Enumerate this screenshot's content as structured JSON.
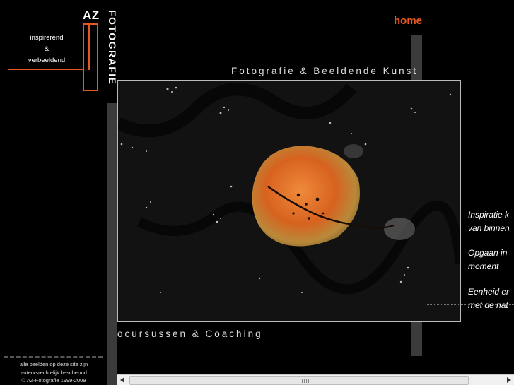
{
  "logo": {
    "az": "AZ",
    "fotografie": "FOTOGRAFIE"
  },
  "slogan": [
    "inspirerend",
    "&",
    "verbeeldend"
  ],
  "nav": {
    "home": "home"
  },
  "header_title": "Fotografie & Beeldende Kunst",
  "footer_title": "ocursussen & Coaching",
  "side_texts": [
    [
      "Inspiratie k",
      "van binnen"
    ],
    [
      "Opgaan in",
      "moment"
    ],
    [
      "Eenheid er",
      "met de nat"
    ]
  ],
  "copyright": [
    "alle beelden op deze site zijn",
    "auteursrechtelijk beschermd",
    "© AZ-Fotografie 1999-2009"
  ],
  "colors": {
    "accent": "#e8571f",
    "background": "#000000",
    "bar": "#3b3b3b"
  }
}
